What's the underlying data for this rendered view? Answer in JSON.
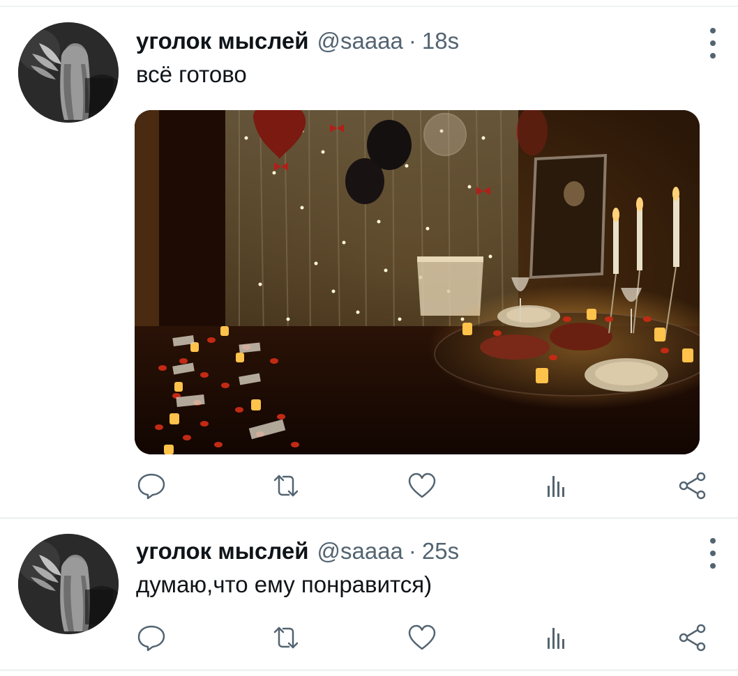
{
  "tweets": [
    {
      "display_name": "уголок мыслей",
      "handle": "@saaaa",
      "separator": "·",
      "time": "18s",
      "text": "всё готово",
      "has_media": true
    },
    {
      "display_name": "уголок мыслей",
      "handle": "@saaaa",
      "separator": "·",
      "time": "25s",
      "text": "думаю,что ему понравится)",
      "has_media": false
    }
  ],
  "icons": {
    "more": "more-vertical-icon",
    "reply": "reply-icon",
    "retweet": "retweet-icon",
    "like": "heart-icon",
    "views": "views-bar-chart-icon",
    "share": "share-icon"
  },
  "colors": {
    "primary_text": "#0f1419",
    "secondary_text": "#536471",
    "divider": "#eff3f4"
  }
}
